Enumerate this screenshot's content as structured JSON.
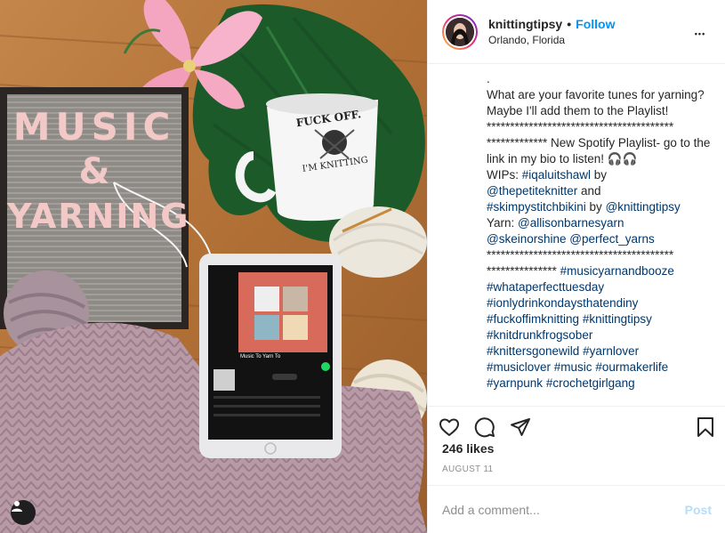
{
  "post": {
    "username": "knittingtipsy",
    "separator": "•",
    "follow_label": "Follow",
    "location": "Orlando, Florida",
    "more_label": "•••",
    "likes": "246 likes",
    "date": "AUGUST 11",
    "comment_placeholder": "Add a comment...",
    "post_label": "Post"
  },
  "photo": {
    "letterboard_line1": "MUSIC",
    "letterboard_line2": "&",
    "letterboard_line3": "YARNING",
    "mug_text_1": "FUCK OFF.",
    "mug_text_2": "I'M KNITTING",
    "tablet_playlist": "Music To Yarn To"
  },
  "caption": {
    "lines": [
      {
        "text": ".",
        "tag": false
      },
      {
        "text": "What are your favorite tunes for yarning? Maybe I'll add them to the Playlist!",
        "tag": false
      },
      {
        "text": "****************************************",
        "tag": false
      },
      {
        "text": "************* New Spotify Playlist- go to the link in my bio to listen! 🎧🎧",
        "tag": false
      },
      {
        "text": "WIPs: ",
        "tag": false,
        "link": "#iqaluitshawl",
        "suffix": " by"
      },
      {
        "text": "",
        "tag": false,
        "link": "@thepetiteknitter",
        "suffix": " and"
      },
      {
        "text": "",
        "tag": false,
        "link": "#skimpystitchbikini",
        "suffix": " by ",
        "link2": "@knittingtipsy"
      },
      {
        "text": "Yarn: ",
        "tag": false,
        "link": "@allisonbarnesyarn"
      },
      {
        "text": "",
        "tag": false,
        "link": "@skeinorshine",
        "suffix": " ",
        "link2": "@perfect_yarns"
      },
      {
        "text": "****************************************",
        "tag": false
      },
      {
        "text": "*************** ",
        "tag": false,
        "link": "#musicyarnandbooze"
      },
      {
        "text": "",
        "tag": false,
        "link": "#whataperfecttuesday"
      },
      {
        "text": "",
        "tag": false,
        "link": "#ionlydrinkondaysthatendiny"
      },
      {
        "text": "",
        "tag": false,
        "link": "#fuckoffimknitting",
        "suffix": " ",
        "link2": "#knittingtipsy"
      },
      {
        "text": "",
        "tag": false,
        "link": "#knitdrunkfrogsober"
      },
      {
        "text": "",
        "tag": false,
        "link": "#knittersgonewild",
        "suffix": " ",
        "link2": "#yarnlover"
      },
      {
        "text": "",
        "tag": false,
        "link": "#musiclover",
        "suffix": " ",
        "link2": "#music",
        "suffix2": " ",
        "link3": "#ourmakerlife"
      },
      {
        "text": "",
        "tag": false,
        "link": "#yarnpunk",
        "suffix": " ",
        "link2": "#crochetgirlgang"
      }
    ]
  },
  "icons": {
    "heart": "heart-icon",
    "comment": "comment-icon",
    "share": "paper-plane-icon",
    "save": "bookmark-icon",
    "user_tag": "user-icon"
  },
  "colors": {
    "link": "#00376b",
    "follow": "#0095f6",
    "post_disabled": "#b2dffc",
    "meta": "#8e8e8e"
  }
}
